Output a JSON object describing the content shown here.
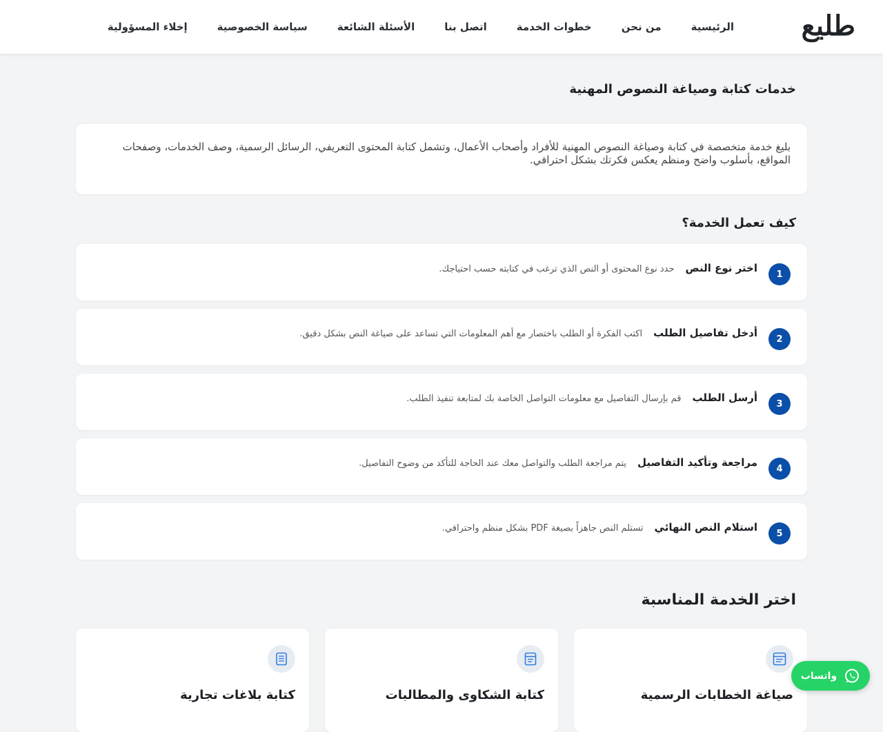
{
  "header": {
    "logo": "طليع",
    "nav": [
      "الرئيسية",
      "من نحن",
      "خطوات الخدمة",
      "اتصل بنا",
      "الأسئلة الشائعة",
      "سياسة الخصوصية",
      "إخلاء المسؤولية"
    ]
  },
  "intro": {
    "title": "خدمات كتابة وصياغة النصوص المهنية",
    "text": "بليغ خدمة متخصصة في كتابة وصياغة النصوص المهنية للأفراد وأصحاب الأعمال، وتشمل كتابة المحتوى التعريفي، الرسائل الرسمية، وصف الخدمات، وصفحات المواقع، بأسلوب واضح ومنظم يعكس فكرتك بشكل احترافي."
  },
  "how": {
    "title": "كيف تعمل الخدمة؟",
    "steps": [
      {
        "num": "1",
        "title": "اختر نوع النص",
        "desc": "حدد نوع المحتوى أو النص الذي ترغب في كتابته حسب احتياجك."
      },
      {
        "num": "2",
        "title": "أدخل تفاصيل الطلب",
        "desc": "اكتب الفكرة أو الطلب باختصار مع أهم المعلومات التي تساعد على صياغة النص بشكل دقيق."
      },
      {
        "num": "3",
        "title": "أرسل الطلب",
        "desc": "قم بإرسال التفاصيل مع معلومات التواصل الخاصة بك لمتابعة تنفيذ الطلب."
      },
      {
        "num": "4",
        "title": "مراجعة وتأكيد التفاصيل",
        "desc": "يتم مراجعة الطلب والتواصل معك عند الحاجة للتأكد من وضوح التفاصيل."
      },
      {
        "num": "5",
        "title": "استلام النص النهائي",
        "desc": "تستلم النص جاهزاً بصيغة PDF بشكل منظم واحترافي."
      }
    ]
  },
  "services": {
    "title": "اختر الخدمة المناسبة",
    "items": [
      {
        "title": "صياغة الخطابات الرسمية",
        "icon": "document-icon"
      },
      {
        "title": "كتابة الشكاوى والمطالبات",
        "icon": "document-icon"
      },
      {
        "title": "كتابة بلاغات تجارية",
        "icon": "document-icon"
      }
    ]
  },
  "whatsapp": {
    "label": "واتساب",
    "icon": "whatsapp-icon"
  },
  "colors": {
    "accent": "#0b4fa8",
    "whatsapp": "#25d366",
    "background": "#f3f4f6"
  }
}
